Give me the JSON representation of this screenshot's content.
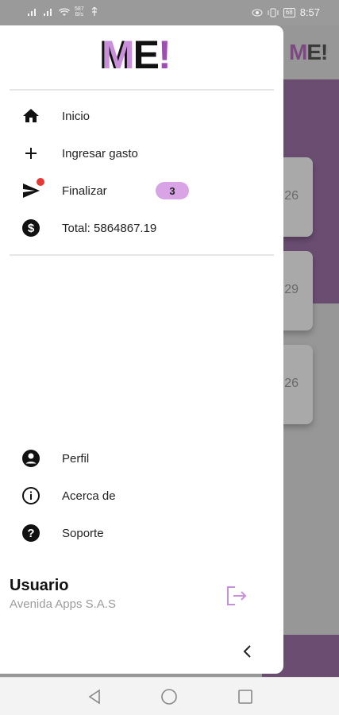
{
  "status_bar": {
    "speed": "587\nB/s",
    "battery": "68",
    "time": "8:57"
  },
  "background": {
    "logo": "ME!",
    "card_values": [
      "26",
      "29",
      "26"
    ]
  },
  "drawer": {
    "logo": {
      "m": "M",
      "e": "E",
      "bang": "!"
    },
    "menu": [
      {
        "label": "Inicio",
        "icon": "home-icon"
      },
      {
        "label": "Ingresar gasto",
        "icon": "plus-icon"
      },
      {
        "label": "Finalizar",
        "icon": "send-icon",
        "badge": "3"
      },
      {
        "label": "Total: 5864867.19",
        "icon": "dollar-icon"
      }
    ],
    "secondary": [
      {
        "label": "Perfil",
        "icon": "account-icon"
      },
      {
        "label": "Acerca de",
        "icon": "info-icon"
      },
      {
        "label": "Soporte",
        "icon": "help-icon"
      }
    ],
    "user": {
      "name": "Usuario",
      "company": "Avenida Apps S.A.S"
    }
  },
  "colors": {
    "accent": "#c98fd8",
    "badge": "#d9a4e6",
    "notification_dot": "#e53935"
  }
}
